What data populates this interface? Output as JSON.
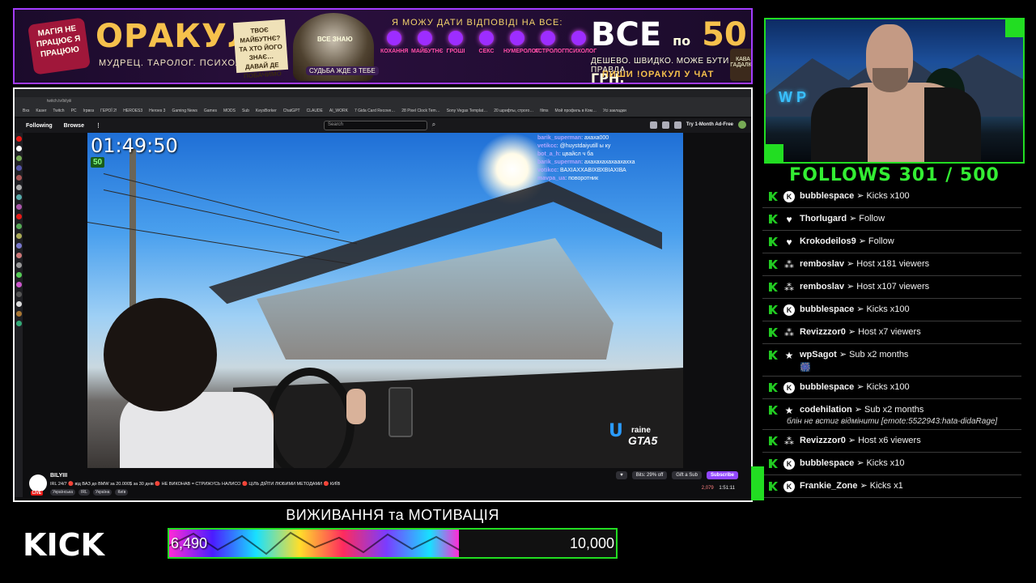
{
  "banner": {
    "magic": "МАГІЯ НЕ ПРАЦЮЄ Я ПРАЦЮЮ",
    "title": "ОРАКУЛ",
    "subtitle": "МУДРЕЦ. ТАРОЛОГ. ПСИХОЛОГ.",
    "note": "ТВОЄ МАЙБУТНЄ? ТА ХТО ЙОГО ЗНАЄ… ДАВАЙ ДЕ ПОБАЧИМО",
    "wizard_sign": "ВСЕ ЗНАЮ",
    "wizard_tag": "СУДЬБА ЖДЕ З ТЕБЕ",
    "answer_line": "Я МОЖУ ДАТИ ВІДПОВІДІ НА ВСЕ:",
    "categories": [
      "КОХАННЯ",
      "МАЙБУТНЄ",
      "ГРОШІ",
      "СЕКС",
      "НУМЕРОЛОГ",
      "АСТРОЛОГ",
      "ПСИХОЛОГ"
    ],
    "price_all": "ВСЕ",
    "price_by": "по",
    "price_value": "50",
    "price_currency": "ГРН.",
    "price_line": "ДЕШЕВО. ШВИДКО. МОЖЕ БУТИ ПРАВДА.",
    "cta": "ПИШИ !ОРАКУЛ У ЧАТ",
    "cup_label": "КАВА ГАДАЛКИ"
  },
  "browser": {
    "url": "twitch.tv/bilyiii",
    "bookmarks": [
      "Bxs",
      "Kaser",
      "Twitch",
      "PC",
      "Ігрвоз",
      "ГЕРОЇ 2!",
      "HEROES3",
      "Heroes 3",
      "Gaming News",
      "Games",
      "MODS",
      "Sub",
      "KeysBorker",
      "ChatGPT",
      "CLAUDE",
      "AI_WORK",
      "7 Gida Card Recove…",
      "28 Pixel Clock Tem…",
      "Sony Vegas Templat…",
      "20 шрифты, строго…",
      "films",
      "Мой профиль в Ком…",
      "Усі закладки"
    ]
  },
  "twitch_nav": {
    "following": "Following",
    "browse": "Browse",
    "menu": "⋮",
    "search_placeholder": "Search",
    "search_icon": "search-icon",
    "ad_free": "Try 1-Month Ad-Free"
  },
  "video": {
    "timer": "01:49:50",
    "badge": "50",
    "chat": [
      {
        "user": "barik_superman",
        "msg": "ахаха000"
      },
      {
        "user": "vetikcc",
        "msg": "@huystdaiyutill ы ку"
      },
      {
        "user": "bot_a_h",
        "msg": "цвайсл ч ба"
      },
      {
        "user": "barik_superman",
        "msg": "ахахахахахаахахха"
      },
      {
        "user": "votikcc",
        "msg": "ВАХІАХХАВІХВХВІАХІВА"
      },
      {
        "user": "mavpa_ua",
        "msg": "поворотник"
      }
    ],
    "logo_big": "U",
    "logo_small": "raine",
    "logo_gta": "GTA5"
  },
  "channel": {
    "name": "BILYIII",
    "live": "LIVE",
    "title": "IRL 24/7 🔴 від ВАЗ до BMW за 20.000$ за 30 днів 🔴 НЕ ВИКОНАВ = СТРИЖУСЬ НАЛИСО 🔴 ЦІЛЬ ДІЙТИ ЛЮБИМИ МЕТОДАМИ 🔴 КИЇВ",
    "tags": [
      "Українська",
      "IRL",
      "Україна",
      "Київ"
    ],
    "bits": "Bits: 29% off",
    "gift": "Gift a Sub",
    "subscribe": "Subscribe",
    "viewers": "2,079",
    "uptime": "1:51:11"
  },
  "follows": "FOLLOWS 301 / 500",
  "events": [
    {
      "icon": "kicks-icon",
      "glyph": "K",
      "user": "bubblespace",
      "action": "Kicks x100"
    },
    {
      "icon": "heart-icon",
      "glyph": "♥",
      "user": "Thorlugard",
      "action": "Follow"
    },
    {
      "icon": "heart-icon",
      "glyph": "♥",
      "user": "Krokodeilos9",
      "action": "Follow"
    },
    {
      "icon": "host-icon",
      "glyph": "⁂",
      "user": "remboslav",
      "action": "Host x181 viewers"
    },
    {
      "icon": "host-icon",
      "glyph": "⁂",
      "user": "remboslav",
      "action": "Host x107 viewers"
    },
    {
      "icon": "kicks-icon",
      "glyph": "K",
      "user": "bubblespace",
      "action": "Kicks x100"
    },
    {
      "icon": "host-icon",
      "glyph": "⁂",
      "user": "Revizzzor0",
      "action": "Host x7 viewers"
    },
    {
      "icon": "star-icon",
      "glyph": "★",
      "user": "wpSagot",
      "action": "Sub x2 months",
      "emote": "🎆"
    },
    {
      "icon": "kicks-icon",
      "glyph": "K",
      "user": "bubblespace",
      "action": "Kicks x100"
    },
    {
      "icon": "star-icon",
      "glyph": "★",
      "user": "codehilation",
      "action": "Sub x2 months",
      "message": "блін не встиг відмінити [emote:5522943:hata-didaRage]"
    },
    {
      "icon": "host-icon",
      "glyph": "⁂",
      "user": "Revizzzor0",
      "action": "Host x6 viewers"
    },
    {
      "icon": "kicks-icon",
      "glyph": "K",
      "user": "bubblespace",
      "action": "Kicks x10"
    },
    {
      "icon": "kicks-icon",
      "glyph": "K",
      "user": "Frankie_Zone",
      "action": "Kicks x1"
    }
  ],
  "arrow": "➢",
  "kick_logo": "KICK",
  "goal": {
    "title": "ВИЖИВАННЯ та МОТИВАЦІЯ",
    "current_label": "6,490",
    "max_label": "10,000",
    "progress": 0.649
  },
  "colors": {
    "accent_green": "#22dd22",
    "banner_border": "#a33cff",
    "twitch_purple": "#9147ff"
  }
}
